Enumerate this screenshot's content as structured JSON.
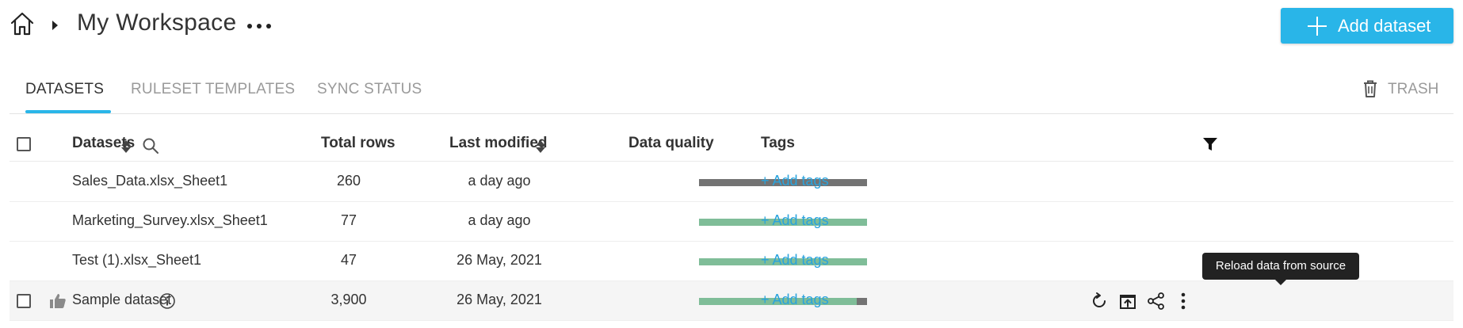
{
  "header": {
    "title": "My Workspace",
    "add_button_label": "Add dataset",
    "accent_color": "#29b5e8"
  },
  "tabs": [
    {
      "label": "DATASETS",
      "active": true
    },
    {
      "label": "RULESET TEMPLATES",
      "active": false
    },
    {
      "label": "SYNC STATUS",
      "active": false
    }
  ],
  "trash_label": "TRASH",
  "table": {
    "columns": {
      "datasets": "Datasets",
      "total_rows": "Total rows",
      "last_modified": "Last modified",
      "data_quality": "Data quality",
      "tags": "Tags"
    },
    "rows": [
      {
        "name": "Sales_Data.xlsx_Sheet1",
        "total_rows": "260",
        "last_modified": "a day ago",
        "quality": {
          "good": 0.0,
          "bad": 0.0,
          "pending": 1.0
        },
        "tags": "+ Add tags"
      },
      {
        "name": "Marketing_Survey.xlsx_Sheet1",
        "total_rows": "77",
        "last_modified": "a day ago",
        "quality": {
          "good": 1.0,
          "bad": 0.0,
          "pending": 0.0
        },
        "tags": "+ Add tags"
      },
      {
        "name": "Test (1).xlsx_Sheet1",
        "total_rows": "47",
        "last_modified": "26 May, 2021",
        "quality": {
          "good": 1.0,
          "bad": 0.0,
          "pending": 0.0
        },
        "tags": "+ Add tags"
      },
      {
        "name": "Sample dataset",
        "total_rows": "3,900",
        "last_modified": "26 May, 2021",
        "quality": {
          "good": 0.94,
          "bad": 0.06,
          "pending": 0.0
        },
        "tags": "+ Add tags"
      }
    ],
    "quality_colors": {
      "good": "#7fbd98",
      "bad": "#737373",
      "pending": "#737373"
    }
  },
  "tooltip": "Reload data from source"
}
